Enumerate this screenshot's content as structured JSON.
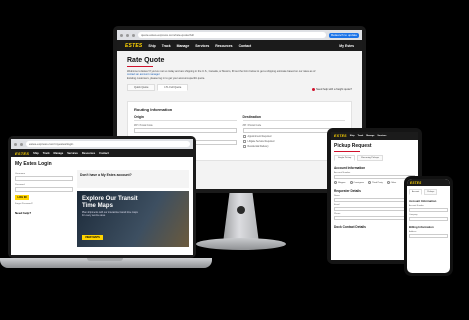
{
  "desktop": {
    "url": "quote.estes-express.com/rate-quote/full",
    "browser_badge": "Relaunch to update",
    "logo": "ESTES",
    "nav": [
      "Ship",
      "Track",
      "Manage",
      "Services",
      "Resources",
      "Contact"
    ],
    "nav_right": "My Estes",
    "title": "Rate Quote",
    "intro": "Welcome to Estes! If you've met us today and are shipping in the U.S., Canada, or Mexico, fill out the form below to get a shipping estimate based on our rates as of",
    "intro_more": "Existing customers, please log in to get your account-specific quote.",
    "intro_link": "contact an account manager",
    "tabs": [
      "Quick Quote",
      "LTL Full Quote"
    ],
    "side_note": "Need help with a freight quote?",
    "card_title": "Routing Information",
    "origin": "Origin",
    "destination": "Destination",
    "zip_label": "ZIP / Postal Code",
    "city_label": "City",
    "checkbox_1": "Appointment Required",
    "checkbox_2": "Liftgate Service Required",
    "checkbox_3": "Residential Delivery"
  },
  "laptop": {
    "url": "estes-express.com/myestes/login",
    "logo": "ESTES",
    "nav": [
      "Ship",
      "Track",
      "Manage",
      "Services",
      "Resources",
      "Contact"
    ],
    "title": "My Estes Login",
    "user_label": "Username",
    "pass_label": "Password",
    "login_button": "LOG IN",
    "forgot": "Forgot Password?",
    "need_help": "Need help?",
    "account_title": "Don't have a My Estes account?",
    "promo_title": "Explore Our Transit Time Maps",
    "promo_sub": "Plan shipments with our interactive transit time maps for every service area.",
    "promo_button": "VIEW MAPS"
  },
  "tablet": {
    "logo": "ESTES",
    "nav": [
      "Ship",
      "Track",
      "Manage",
      "Services",
      "Resources"
    ],
    "title": "Pickup Request",
    "tabs": [
      "Single Pickup",
      "Recurring Pickups"
    ],
    "account_section": "Account Information",
    "account_label": "Account Number",
    "role_options": [
      "Shipper",
      "Consignee",
      "Third Party",
      "Other"
    ],
    "requester_section": "Requester Details",
    "name_label": "Name",
    "email_label": "Email",
    "phone_label": "Phone",
    "dock_section": "Dock Contact Details"
  },
  "phone": {
    "logo": "ESTES",
    "tabs": [
      "Account",
      "Pickups"
    ],
    "account_section": "Account Information",
    "billing_section": "Billing Information",
    "label_1": "Account Number",
    "label_2": "Company",
    "label_3": "Address"
  }
}
